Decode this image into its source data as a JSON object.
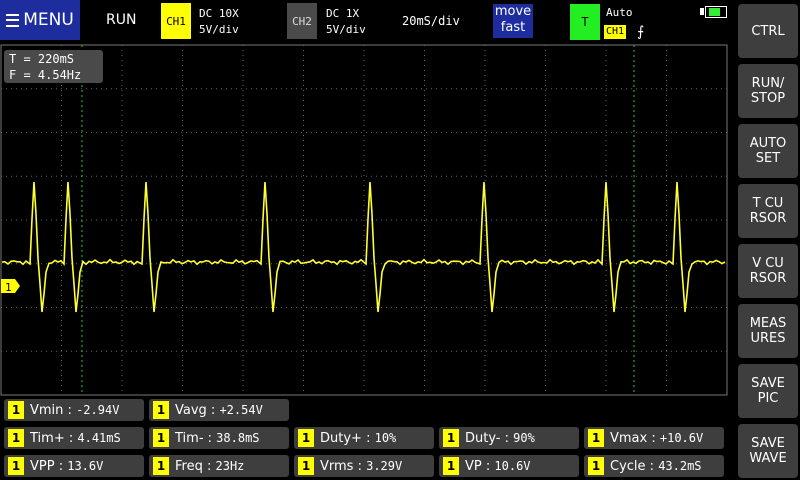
{
  "topbar": {
    "menu_label": "MENU",
    "run_state": "RUN",
    "ch1": {
      "label": "CH1",
      "coupling": "DC  10X",
      "scale": "5V/div"
    },
    "ch2": {
      "label": "CH2",
      "coupling": "DC  1X",
      "scale": "5V/div"
    },
    "timebase": "20mS/div",
    "move": {
      "line1": "move",
      "line2": "fast"
    },
    "trigger": {
      "label": "T",
      "mode": "Auto",
      "channel": "CH1",
      "edge": "⨍"
    },
    "battery_level": 0.8
  },
  "scope": {
    "readout_t": "T = 220mS",
    "readout_f": "F = 4.54Hz",
    "channel_marker": "1",
    "trace_color": "#ffff33"
  },
  "measurements": [
    {
      "ch": "1",
      "name": "Vmin",
      "value": "-2.94V"
    },
    {
      "ch": "1",
      "name": "Vavg",
      "value": "+2.54V"
    },
    {
      "ch": "1",
      "name": "Tim+",
      "value": "4.41mS"
    },
    {
      "ch": "1",
      "name": "Tim-",
      "value": "38.8mS"
    },
    {
      "ch": "1",
      "name": "Duty+",
      "value": "10%"
    },
    {
      "ch": "1",
      "name": "Duty-",
      "value": "90%"
    },
    {
      "ch": "1",
      "name": "Vmax",
      "value": "+10.6V"
    },
    {
      "ch": "1",
      "name": "VPP",
      "value": "13.6V"
    },
    {
      "ch": "1",
      "name": "Freq",
      "value": "23Hz"
    },
    {
      "ch": "1",
      "name": "Vrms",
      "value": "3.29V"
    },
    {
      "ch": "1",
      "name": "VP",
      "value": "10.6V"
    },
    {
      "ch": "1",
      "name": "Cycle",
      "value": "43.2mS"
    }
  ],
  "sidebar": [
    {
      "label": "CTRL"
    },
    {
      "label": "RUN/\nSTOP"
    },
    {
      "label": "AUTO\nSET"
    },
    {
      "label": "T CU\nRSOR"
    },
    {
      "label": "V CU\nRSOR"
    },
    {
      "label": "MEAS\nURES"
    },
    {
      "label": "SAVE\nPIC"
    },
    {
      "label": "SAVE\nWAVE"
    }
  ]
}
